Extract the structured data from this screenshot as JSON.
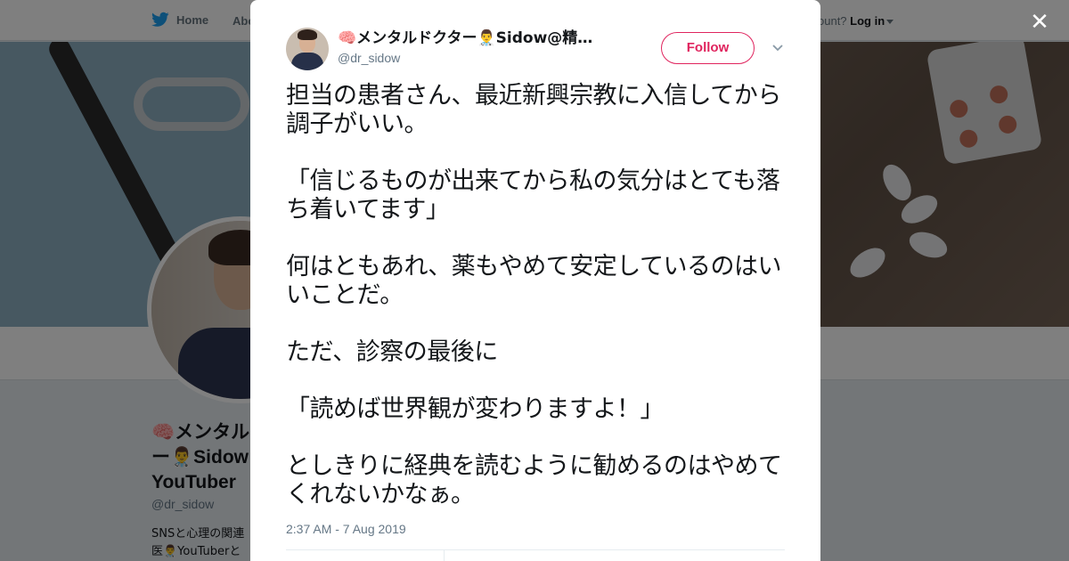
{
  "nav": {
    "home_label": "Home",
    "about_label": "Abo",
    "account_prompt": "ccount?",
    "login_label": "Log in"
  },
  "profile": {
    "name": "🧠メンタルドクター👨‍⚕️Sidow@精神科医YouTuber",
    "name_visible": "🧠メンタル\nー👨‍⚕️Sidow\nYouTuber",
    "handle": "@dr_sidow",
    "bio_visible": "SNSと心理の関連\n医👨‍⚕️YouTuberと"
  },
  "tweet": {
    "display_name": "🧠メンタルドクター👨‍⚕️Sidow@精…",
    "handle": "@dr_sidow",
    "follow_label": "Follow",
    "text": "担当の患者さん、最近新興宗教に入信してから調子がいい。\n\n「信じるものが出来てから私の気分はとても落ち着いてます」\n\n何はともあれ、薬もやめて安定しているのはいいことだ。\n\nただ、診察の最後に\n\n「読めば世界観が変わりますよ！」\n\nとしきりに経典を読むように勧めるのはやめてくれないかなぁ。",
    "timestamp": "2:37 AM - 7 Aug 2019"
  },
  "colors": {
    "twitter_blue": "#1da1f2",
    "follow_accent": "#e0245e",
    "text_primary": "#14171a",
    "text_secondary": "#657786"
  },
  "icons": {
    "bird": "twitter-bird-icon",
    "close": "close-icon",
    "chevron": "chevron-down-icon"
  }
}
